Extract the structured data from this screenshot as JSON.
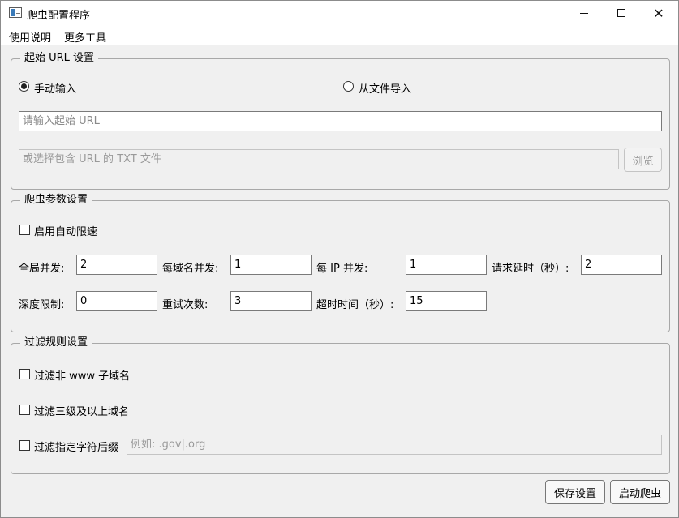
{
  "window": {
    "title": "爬虫配置程序"
  },
  "menu": {
    "items": [
      "使用说明",
      "更多工具"
    ]
  },
  "start_url": {
    "group_title": "起始 URL 设置",
    "radio_manual": "手动输入",
    "radio_file": "从文件导入",
    "manual_checked": true,
    "url_placeholder": "请输入起始 URL",
    "file_placeholder": "或选择包含 URL 的 TXT 文件",
    "browse_label": "浏览"
  },
  "crawler": {
    "group_title": "爬虫参数设置",
    "autothrottle_label": "启用自动限速",
    "fields": {
      "global_concurrency": {
        "label": "全局并发:",
        "value": "2"
      },
      "per_domain": {
        "label": "每域名并发:",
        "value": "1"
      },
      "per_ip": {
        "label": "每 IP 并发:",
        "value": "1"
      },
      "delay": {
        "label": "请求延时（秒）:",
        "value": "2"
      },
      "depth": {
        "label": "深度限制:",
        "value": "0"
      },
      "retry": {
        "label": "重试次数:",
        "value": "3"
      },
      "timeout": {
        "label": "超时时间（秒）:",
        "value": "15"
      }
    }
  },
  "filter": {
    "group_title": "过滤规则设置",
    "non_www_label": "过滤非 www 子域名",
    "third_level_label": "过滤三级及以上域名",
    "suffix_label": "过滤指定字符后缀",
    "suffix_placeholder": "例如: .gov|.org"
  },
  "footer": {
    "save_label": "保存设置",
    "start_label": "启动爬虫"
  }
}
